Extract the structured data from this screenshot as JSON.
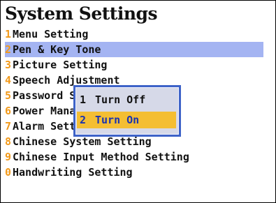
{
  "title": "System Settings",
  "menu": {
    "items": [
      {
        "num": "1",
        "label": "Menu Setting"
      },
      {
        "num": "2",
        "label": "Pen & Key Tone",
        "selected": true
      },
      {
        "num": "3",
        "label": "Picture Setting"
      },
      {
        "num": "4",
        "label": "Speech Adjustment"
      },
      {
        "num": "5",
        "label": "Password Setting"
      },
      {
        "num": "6",
        "label": "Power Management"
      },
      {
        "num": "7",
        "label": "Alarm Setting"
      },
      {
        "num": "8",
        "label": "Chinese System Setting"
      },
      {
        "num": "9",
        "label": "Chinese Input Method Setting"
      },
      {
        "num": "0",
        "label": "Handwriting Setting"
      }
    ]
  },
  "popup": {
    "options": [
      {
        "num": "1",
        "label": "Turn Off"
      },
      {
        "num": "2",
        "label": "Turn On",
        "selected": true
      }
    ]
  },
  "colors": {
    "number_accent": "#f29a1b",
    "selected_row": "#a4b4f2",
    "popup_border": "#3e63c8",
    "popup_bg": "#d6d9e8",
    "popup_selected": "#f4be33",
    "popup_selected_text": "#1b33b0"
  }
}
